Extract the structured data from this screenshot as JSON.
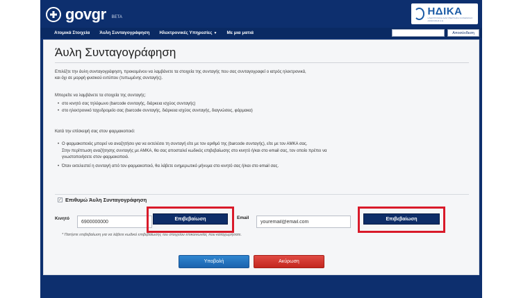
{
  "header": {
    "brand_main": "gov",
    "brand_accent": "gr",
    "brand_beta": "BETA",
    "partner_logo": "ΗΔΙΚΑ",
    "partner_sub": "ΗΛΕΚΤΡΟΝΙΚΗ ΔΙΑΚΥΒΕΡΝΗΣΗ ΚΟΙΝΩΝΙΚΗΣ ΑΣΦΑΛΙΣΗΣ Α.Ε."
  },
  "nav": {
    "items": [
      {
        "label": "Ατομικά Στοιχεία"
      },
      {
        "label": "Άυλη Συνταγογράφηση"
      },
      {
        "label": "Ηλεκτρονικές Υπηρεσίες",
        "has_dropdown": true
      },
      {
        "label": "Με μια ματιά"
      }
    ],
    "search_value": "",
    "logout_label": "Αποσύνδεση"
  },
  "page": {
    "title": "Άυλη Συνταγογράφηση",
    "intro_line1": "Επιλέξτε την άυλη συνταγογράφηση, προκειμένου να λαμβάνετε τα στοιχεία της συνταγής που σας συνταγογραφεί ο ιατρός ηλεκτρονικά,",
    "intro_line2": "και όχι σε μορφή φυσικού εντύπου (τυπωμένης συνταγής).",
    "receive_heading": "Μπορείτε να λαμβάνετε τα στοιχεία της συνταγής:",
    "receive_bullets": [
      "στο κινητό σας τηλέφωνο (barcode συνταγής, διάρκεια ισχύος συνταγής)",
      "στο ηλεκτρονικό ταχυδρομείο σας (barcode συνταγής, διάρκεια ισχύος συνταγής, διαγνώσεις, φάρμακα)"
    ],
    "pharmacy_heading": "Κατά την επίσκεψή σας στον φαρμακοποιό:",
    "pharmacy_bullet1_line1": "Ο φαρμακοποιός μπορεί να αναζητήσει για να εκτελέσει τη συνταγή είτε με τον αριθμό της (barcode συνταγής), είτε με τον ΑΜΚΑ σας.",
    "pharmacy_bullet1_line2": "Στην περίπτωση αναζήτησης συνταγής με ΑΜΚΑ, θα σας αποσταλεί κωδικός επιβεβαίωσης στο κινητό ή/και στο email σας, τον οποίο πρέπει να",
    "pharmacy_bullet1_line3": "γνωστοποιήσετε στον φαρμακοποιό.",
    "pharmacy_bullet2": "Όταν εκτελεστεί η συνταγή από τον φαρμακοποιό, θα λάβετε ενημερωτικό μήνυμα στο κινητό σας ή/και στο email σας."
  },
  "form": {
    "opt_in_label": "Επιθυμώ Άυλη Συνταγογράφηση",
    "opt_in_checked": true,
    "mobile_label": "Κινητό",
    "mobile_value": "6900000000",
    "mobile_verify_label": "Επιβεβαίωση",
    "email_label": "Email",
    "email_value": "youremail@email.com",
    "email_verify_label": "Επιβεβαίωση",
    "note": "* Πατήστε επιβεβαίωση για να λάβετε κωδικό επιβεβαίωσης του στοιχείου επικοινωνίας που καταχωρήσατε.",
    "submit_label": "Υποβολή",
    "cancel_label": "Ακύρωση"
  },
  "colors": {
    "navy": "#0d2f6e",
    "highlight_red": "#d91a2a",
    "submit_blue": "#1b63ae",
    "cancel_red": "#c3271f"
  }
}
